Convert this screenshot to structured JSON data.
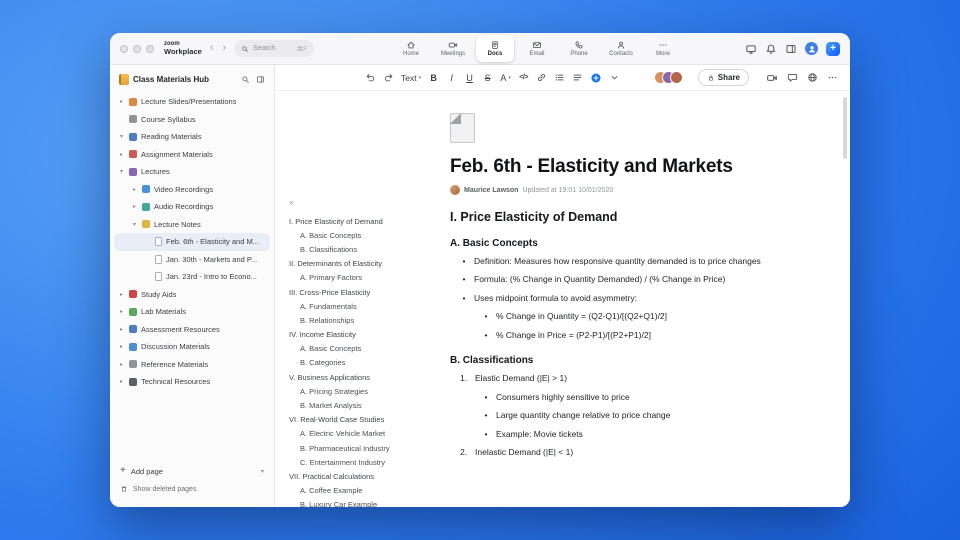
{
  "titlebar": {
    "logo_line1": "zoom",
    "logo_line2": "Workplace",
    "search": {
      "placeholder": "Search",
      "shortcut": "⌘F"
    },
    "tabs": [
      {
        "label": "Home",
        "icon": "home-icon",
        "active": false
      },
      {
        "label": "Meetings",
        "icon": "meetings-icon",
        "active": false
      },
      {
        "label": "Docs",
        "icon": "docs-icon",
        "active": true
      },
      {
        "label": "Email",
        "icon": "email-icon",
        "active": false
      },
      {
        "label": "Phone",
        "icon": "phone-icon",
        "active": false
      },
      {
        "label": "Contacts",
        "icon": "contacts-icon",
        "active": false
      },
      {
        "label": "More",
        "icon": "more-icon",
        "active": false
      }
    ]
  },
  "sidebar": {
    "title": "Class Materials Hub",
    "items": [
      {
        "label": "Lecture Slides/Presentations",
        "level": 0,
        "chevron": "right",
        "icon": "chart-icon",
        "icon_color": "#e0873f",
        "selected": false
      },
      {
        "label": "Course Syllabus",
        "level": 0,
        "chevron": "none",
        "icon": "clipboard-icon",
        "icon_color": "#8f949b",
        "selected": false
      },
      {
        "label": "Reading Materials",
        "level": 0,
        "chevron": "down",
        "icon": "book-icon",
        "icon_color": "#4a7fc1",
        "selected": false
      },
      {
        "label": "Assignment Materials",
        "level": 0,
        "chevron": "right",
        "icon": "target-icon",
        "icon_color": "#cf5a4e",
        "selected": false
      },
      {
        "label": "Lectures",
        "level": 0,
        "chevron": "down",
        "icon": "tag-icon",
        "icon_color": "#8a63b8",
        "selected": false
      },
      {
        "label": "Video Recordings",
        "level": 1,
        "chevron": "right",
        "icon": "video-icon",
        "icon_color": "#4a90d9",
        "selected": false
      },
      {
        "label": "Audio Recordings",
        "level": 1,
        "chevron": "right",
        "icon": "headphones-icon",
        "icon_color": "#3fa79b",
        "selected": false
      },
      {
        "label": "Lecture Notes",
        "level": 1,
        "chevron": "down",
        "icon": "notes-icon",
        "icon_color": "#e0b53c",
        "selected": false
      },
      {
        "label": "Feb. 6th - Elasticity and M...",
        "level": 2,
        "chevron": "none",
        "icon": "page-icon",
        "icon_color": "",
        "selected": true
      },
      {
        "label": "Jan. 30th - Markets and P...",
        "level": 2,
        "chevron": "none",
        "icon": "page-icon",
        "icon_color": "",
        "selected": false
      },
      {
        "label": "Jan. 23rd - Intro to Econo...",
        "level": 2,
        "chevron": "none",
        "icon": "page-icon",
        "icon_color": "",
        "selected": false
      },
      {
        "label": "Study Aids",
        "level": 0,
        "chevron": "right",
        "icon": "apple-icon",
        "icon_color": "#d04545",
        "selected": false
      },
      {
        "label": "Lab Materials",
        "level": 0,
        "chevron": "right",
        "icon": "flask-icon",
        "icon_color": "#57a85c",
        "selected": false
      },
      {
        "label": "Assessment Resources",
        "level": 0,
        "chevron": "right",
        "icon": "ruler-icon",
        "icon_color": "#4a7fc1",
        "selected": false
      },
      {
        "label": "Discussion Materials",
        "level": 0,
        "chevron": "right",
        "icon": "chat-bubble-icon",
        "icon_color": "#4a90d9",
        "selected": false
      },
      {
        "label": "Reference Materials",
        "level": 0,
        "chevron": "right",
        "icon": "paperclip-icon",
        "icon_color": "#8f949b",
        "selected": false
      },
      {
        "label": "Technical Resources",
        "level": 0,
        "chevron": "right",
        "icon": "manual-icon",
        "icon_color": "#5a6069",
        "selected": false
      }
    ],
    "add_page_label": "Add page",
    "show_deleted_label": "Show deleted pages"
  },
  "toolbar": {
    "buttons": [
      {
        "name": "undo-button",
        "icon": "undo-icon"
      },
      {
        "name": "redo-button",
        "icon": "redo-icon"
      },
      {
        "name": "text-style-dropdown",
        "label": "Text",
        "dropdown": true
      },
      {
        "name": "bold-button",
        "label": "B",
        "style": "b"
      },
      {
        "name": "italic-button",
        "label": "I",
        "style": "i"
      },
      {
        "name": "underline-button",
        "label": "U",
        "style": "u"
      },
      {
        "name": "strikethrough-button",
        "label": "S",
        "style": "s"
      },
      {
        "name": "text-color-button",
        "label": "A",
        "dropdown": true
      },
      {
        "name": "code-button",
        "label": "</>",
        "code": true
      },
      {
        "name": "link-button",
        "icon": "link-icon"
      },
      {
        "name": "bullet-list-button",
        "icon": "list-icon"
      },
      {
        "name": "align-button",
        "icon": "align-icon"
      },
      {
        "name": "insert-button",
        "icon": "plus-circle-icon"
      },
      {
        "name": "toolbar-collapse-button",
        "icon": "chevron-down-icon"
      }
    ],
    "share_label": "Share",
    "avatars": [
      {
        "color": "#d98e5f"
      },
      {
        "color": "#8a64a8"
      },
      {
        "color": "#b5654a"
      }
    ]
  },
  "document": {
    "title": "Feb. 6th - Elasticity and Markets",
    "author": "Maurice Lawson",
    "updated": "Updated at 19:01 10/01/2020",
    "toc": [
      {
        "text": "I. Price Elasticity of Demand",
        "level": 0
      },
      {
        "text": "A. Basic Concepts",
        "level": 1
      },
      {
        "text": "B. Classifications",
        "level": 1
      },
      {
        "text": "II. Determinants of Elasticity",
        "level": 0
      },
      {
        "text": "A. Primary Factors",
        "level": 1
      },
      {
        "text": "III. Cross-Price Elasticity",
        "level": 0
      },
      {
        "text": "A. Fundamentals",
        "level": 1
      },
      {
        "text": "B. Relationships",
        "level": 1
      },
      {
        "text": "IV. Income Elasticity",
        "level": 0
      },
      {
        "text": "A. Basic Concepts",
        "level": 1
      },
      {
        "text": "B. Categories",
        "level": 1
      },
      {
        "text": "V. Business Applications",
        "level": 0
      },
      {
        "text": "A. Pricing Strategies",
        "level": 1
      },
      {
        "text": "B. Market Analysis",
        "level": 1
      },
      {
        "text": "VI. Real-World Case Studies",
        "level": 0
      },
      {
        "text": "A. Electric Vehicle Market",
        "level": 1
      },
      {
        "text": "B. Pharmaceutical Industry",
        "level": 1
      },
      {
        "text": "C. Entertainment Industry",
        "level": 1
      },
      {
        "text": "VII. Practical Calculations",
        "level": 0
      },
      {
        "text": "A. Coffee Example",
        "level": 1
      },
      {
        "text": "B. Luxury Car Example",
        "level": 1
      }
    ],
    "blocks": [
      {
        "type": "h2",
        "text": "I. Price Elasticity of Demand"
      },
      {
        "type": "h3",
        "text": "A. Basic Concepts"
      },
      {
        "type": "bullet",
        "level": 1,
        "text": "Definition: Measures how responsive quantity demanded is to price changes"
      },
      {
        "type": "bullet",
        "level": 1,
        "text": "Formula: (% Change in Quantity Demanded) / (% Change in Price)"
      },
      {
        "type": "bullet",
        "level": 1,
        "text": "Uses midpoint formula to avoid asymmetry:"
      },
      {
        "type": "bullet",
        "level": 2,
        "text": "% Change in Quantity = (Q2-Q1)/[(Q2+Q1)/2]"
      },
      {
        "type": "bullet",
        "level": 2,
        "text": "% Change in Price = (P2-P1)/[(P2+P1)/2]"
      },
      {
        "type": "h3",
        "text": "B. Classifications"
      },
      {
        "type": "num",
        "marker": "1.",
        "text": "Elastic Demand (|E| > 1)"
      },
      {
        "type": "bullet",
        "level": 2,
        "text": "Consumers highly sensitive to price"
      },
      {
        "type": "bullet",
        "level": 2,
        "text": "Large quantity change relative to price change"
      },
      {
        "type": "bullet",
        "level": 2,
        "text": "Example: Movie tickets"
      },
      {
        "type": "num",
        "marker": "2.",
        "text": "Inelastic Demand (|E| < 1)"
      }
    ]
  }
}
